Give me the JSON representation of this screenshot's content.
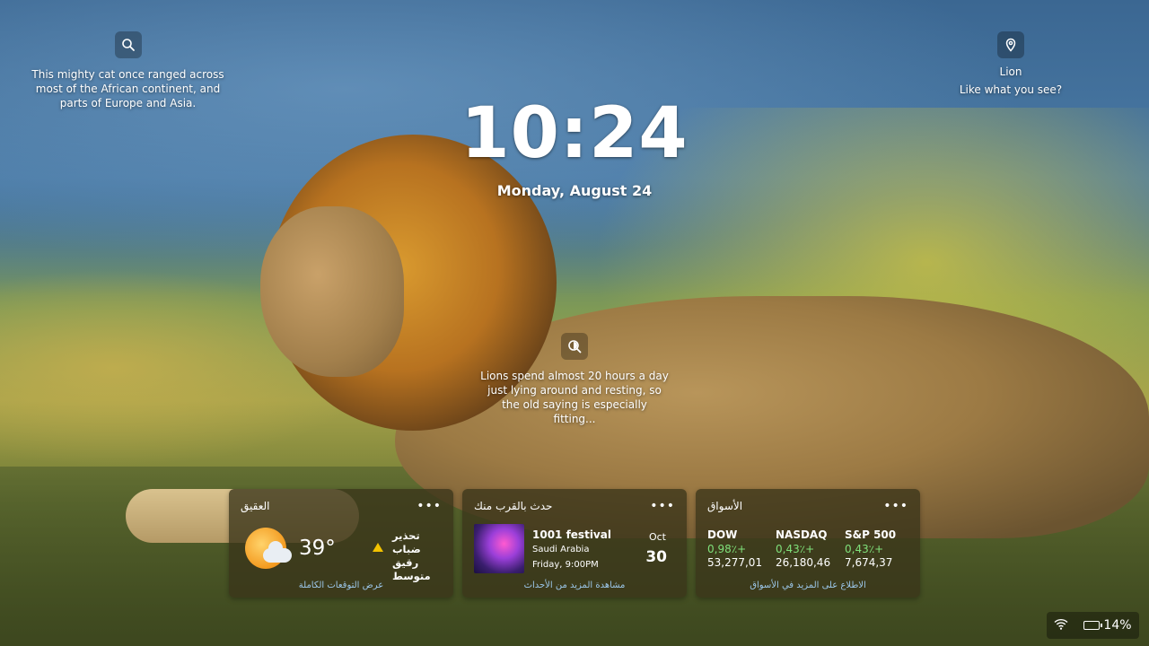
{
  "background": {
    "photo_subject": "lion"
  },
  "fact_left": {
    "icon": "search-icon",
    "text": "This mighty cat once ranged across most of the African continent, and parts of Europe and Asia."
  },
  "fact_right": {
    "icon": "location-pin-icon",
    "title": "Lion",
    "subtitle": "Like what you see?"
  },
  "fact_center": {
    "icon": "zoom-icon",
    "text": "Lions spend almost 20 hours a day just lying around and resting, so the old saying is especially fitting..."
  },
  "clock": {
    "time": "10:24",
    "date": "Monday, August 24"
  },
  "widgets": {
    "weather": {
      "title": "العقيق",
      "more": "•••",
      "temperature": "39°",
      "icon": "sun-cloud-icon",
      "warning_icon": "warning-icon",
      "warning_text": "تحذير ضباب رقيق متوسط",
      "footer": "عرض التوقعات الكاملة"
    },
    "events": {
      "title": "حدث بالقرب منك",
      "more": "•••",
      "event_name": "1001 festival",
      "location": "Saudi Arabia",
      "time": "Friday, 9:00PM",
      "month": "Oct",
      "day": "30",
      "footer": "مشاهدة المزيد من الأحداث"
    },
    "markets": {
      "title": "الأسواق",
      "more": "•••",
      "indices": [
        {
          "name": "DOW",
          "change": "0,98٪+",
          "value": "53,277,01"
        },
        {
          "name": "NASDAQ",
          "change": "0,43٪+",
          "value": "26,180,46"
        },
        {
          "name": "S&P 500",
          "change": "0,43٪+",
          "value": "7,674,37"
        }
      ],
      "footer": "الاطلاع على المزيد في الأسواق"
    }
  },
  "status": {
    "wifi_icon": "wifi-icon",
    "battery_icon": "battery-icon",
    "battery": "14%"
  },
  "colors": {
    "positive": "#7fe07a",
    "link": "#9cc7ea",
    "widget_bg": "#3a3419"
  }
}
